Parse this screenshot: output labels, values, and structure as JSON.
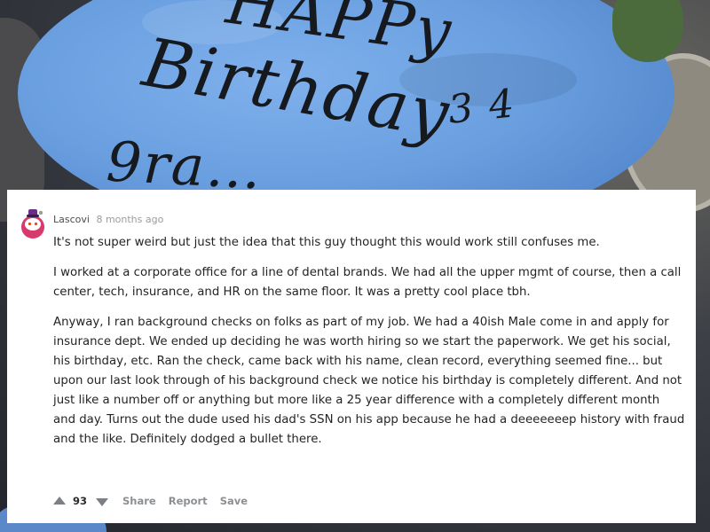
{
  "photo": {
    "cake_lines": [
      "HAPPy",
      "Birthday",
      "3 4",
      "9ra…"
    ]
  },
  "comment": {
    "username": "Lascovi",
    "timestamp": "8 months ago",
    "paragraphs": [
      "It's not super weird but just the idea that this guy thought this would work still confuses me.",
      "I worked at a corporate office for a line of dental brands. We had all the upper mgmt of course, then a call center, tech, insurance, and HR on the same floor. It was a pretty cool place tbh.",
      "Anyway, I ran background checks on folks as part of my job. We had a 40ish Male come in and apply for insurance dept. We ended up deciding he was worth hiring so we start the paperwork. We get his social, his birthday, etc. Ran the check, came back with his name, clean record, everything seemed fine... but upon our last look through of his background check we notice his birthday is completely different. And not just like a number off or anything but more like a 25 year difference with a completely different month and day. Turns out the dude used his dad's SSN on his app because he had a deeeeeeep history with fraud and the like. Definitely dodged a bullet there."
    ],
    "score": "93",
    "actions": {
      "share": "Share",
      "report": "Report",
      "save": "Save"
    }
  },
  "colors": {
    "cake_blue": "#6a9fe0",
    "card_bg": "#ffffff",
    "text": "#222426",
    "muted": "#8c8f94"
  },
  "icons": {
    "avatar": "snoo-avatar-icon",
    "upvote": "upvote-arrow-icon",
    "downvote": "downvote-arrow-icon"
  }
}
